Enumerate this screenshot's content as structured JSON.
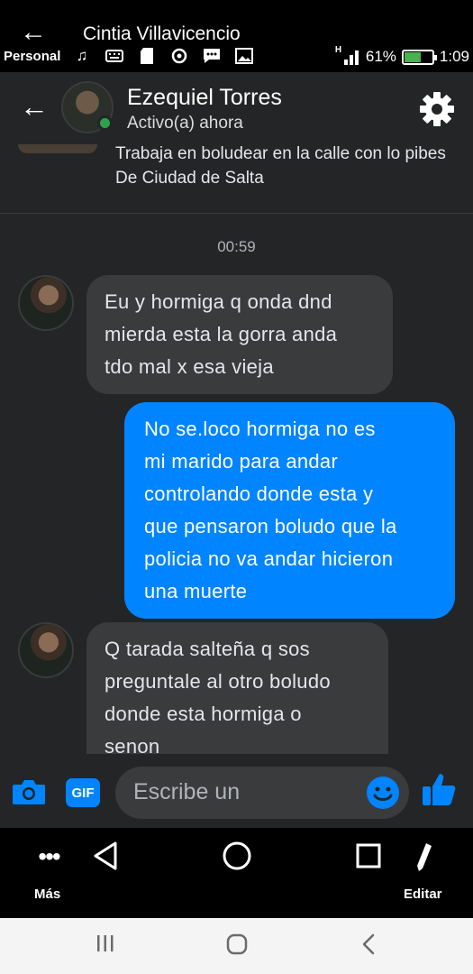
{
  "viewer": {
    "back_icon": "arrow-left-icon",
    "title": "Cintia Villavicencio"
  },
  "status_bar": {
    "carrier": "Personal",
    "icons": [
      "music-note-icon",
      "keyboard-icon",
      "sd-card-icon",
      "sync-icon",
      "messenger-icon",
      "image-icon"
    ],
    "battery_percent": "61%",
    "battery_level": 0.61,
    "time": "1:09",
    "signal_label": "H"
  },
  "chat_header": {
    "contact_name": "Ezequiel Torres",
    "presence": "Activo(a) ahora"
  },
  "conversation": {
    "bio_lines": [
      "Trabaja en boludear en la calle con lo pibes",
      "De Ciudad de Salta"
    ],
    "timestamp": "00:59",
    "messages": [
      {
        "direction": "incoming",
        "lines": [
          "Eu y hormiga q onda dnd",
          "mierda esta la gorra anda",
          "tdo mal x esa vieja"
        ]
      },
      {
        "direction": "outgoing",
        "lines": [
          "No se.loco hormiga no es",
          "mi marido para andar",
          "controlando donde esta y",
          "que pensaron boludo que la",
          "policia no va andar hicieron",
          "una muerte"
        ]
      },
      {
        "direction": "incoming",
        "lines": [
          "Q tarada salteña q sos",
          "preguntale al otro boludo",
          "donde esta hormiga o",
          "senon"
        ]
      }
    ]
  },
  "composer": {
    "placeholder": "Escribe un",
    "gif_label": "GIF"
  },
  "viewer_toolbar": {
    "more_label": "Más",
    "edit_label": "Editar"
  },
  "colors": {
    "outgoing_bubble": "#0084ff",
    "incoming_bubble": "#3a3b3c",
    "chat_background": "#242526",
    "online_dot": "#31a24c"
  }
}
